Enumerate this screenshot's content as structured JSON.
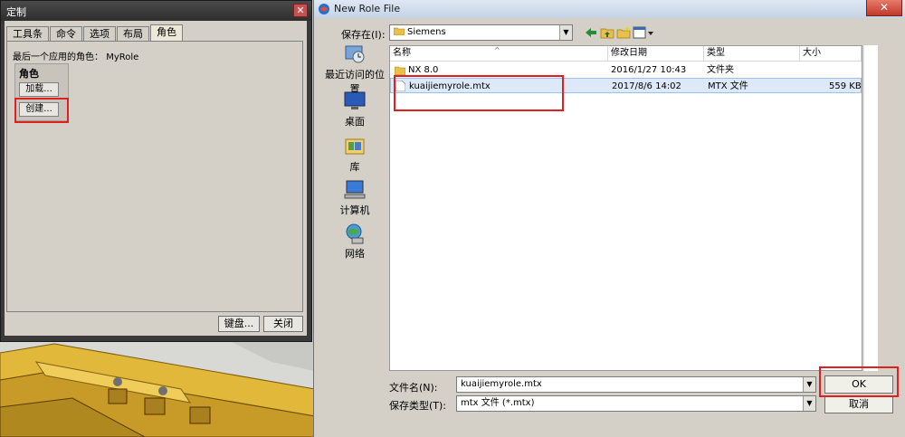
{
  "customize": {
    "title": "定制",
    "close_glyph": "✕",
    "tabs": [
      "工具条",
      "命令",
      "选项",
      "布局",
      "角色"
    ],
    "active_tab": 4,
    "last_role_label": "最后一个应用的角色：",
    "last_role_value": "MyRole",
    "roles_group_title": "角色",
    "load_button": "加载...",
    "create_button": "创建...",
    "keyboard_button": "键盘...",
    "close_button": "关闭"
  },
  "file_dialog": {
    "title": "New Role File",
    "close_glyph": "✕",
    "save_in_label": "保存在(I):",
    "save_in_value": "Siemens",
    "places": [
      {
        "label": "最近访问的位置",
        "icon": "recent-places-icon"
      },
      {
        "label": "桌面",
        "icon": "desktop-icon"
      },
      {
        "label": "库",
        "icon": "libraries-icon"
      },
      {
        "label": "计算机",
        "icon": "computer-icon"
      },
      {
        "label": "网络",
        "icon": "network-icon"
      }
    ],
    "columns": [
      "名称",
      "修改日期",
      "类型",
      "大小"
    ],
    "files": [
      {
        "name": "NX 8.0",
        "date": "2016/1/27 10:43",
        "type": "文件夹",
        "size": "",
        "icon": "folder-icon"
      },
      {
        "name": "kuaijiemyrole.mtx",
        "date": "2017/8/6 14:02",
        "type": "MTX 文件",
        "size": "559 KB",
        "icon": "file-icon"
      }
    ],
    "filename_label": "文件名(N):",
    "filename_value": "kuaijiemyrole.mtx",
    "filetype_label": "保存类型(T):",
    "filetype_value": "mtx 文件 (*.mtx)",
    "ok_button": "OK",
    "cancel_button": "取消"
  },
  "colors": {
    "highlight": "#e02020",
    "selection": "#dde8f8"
  }
}
